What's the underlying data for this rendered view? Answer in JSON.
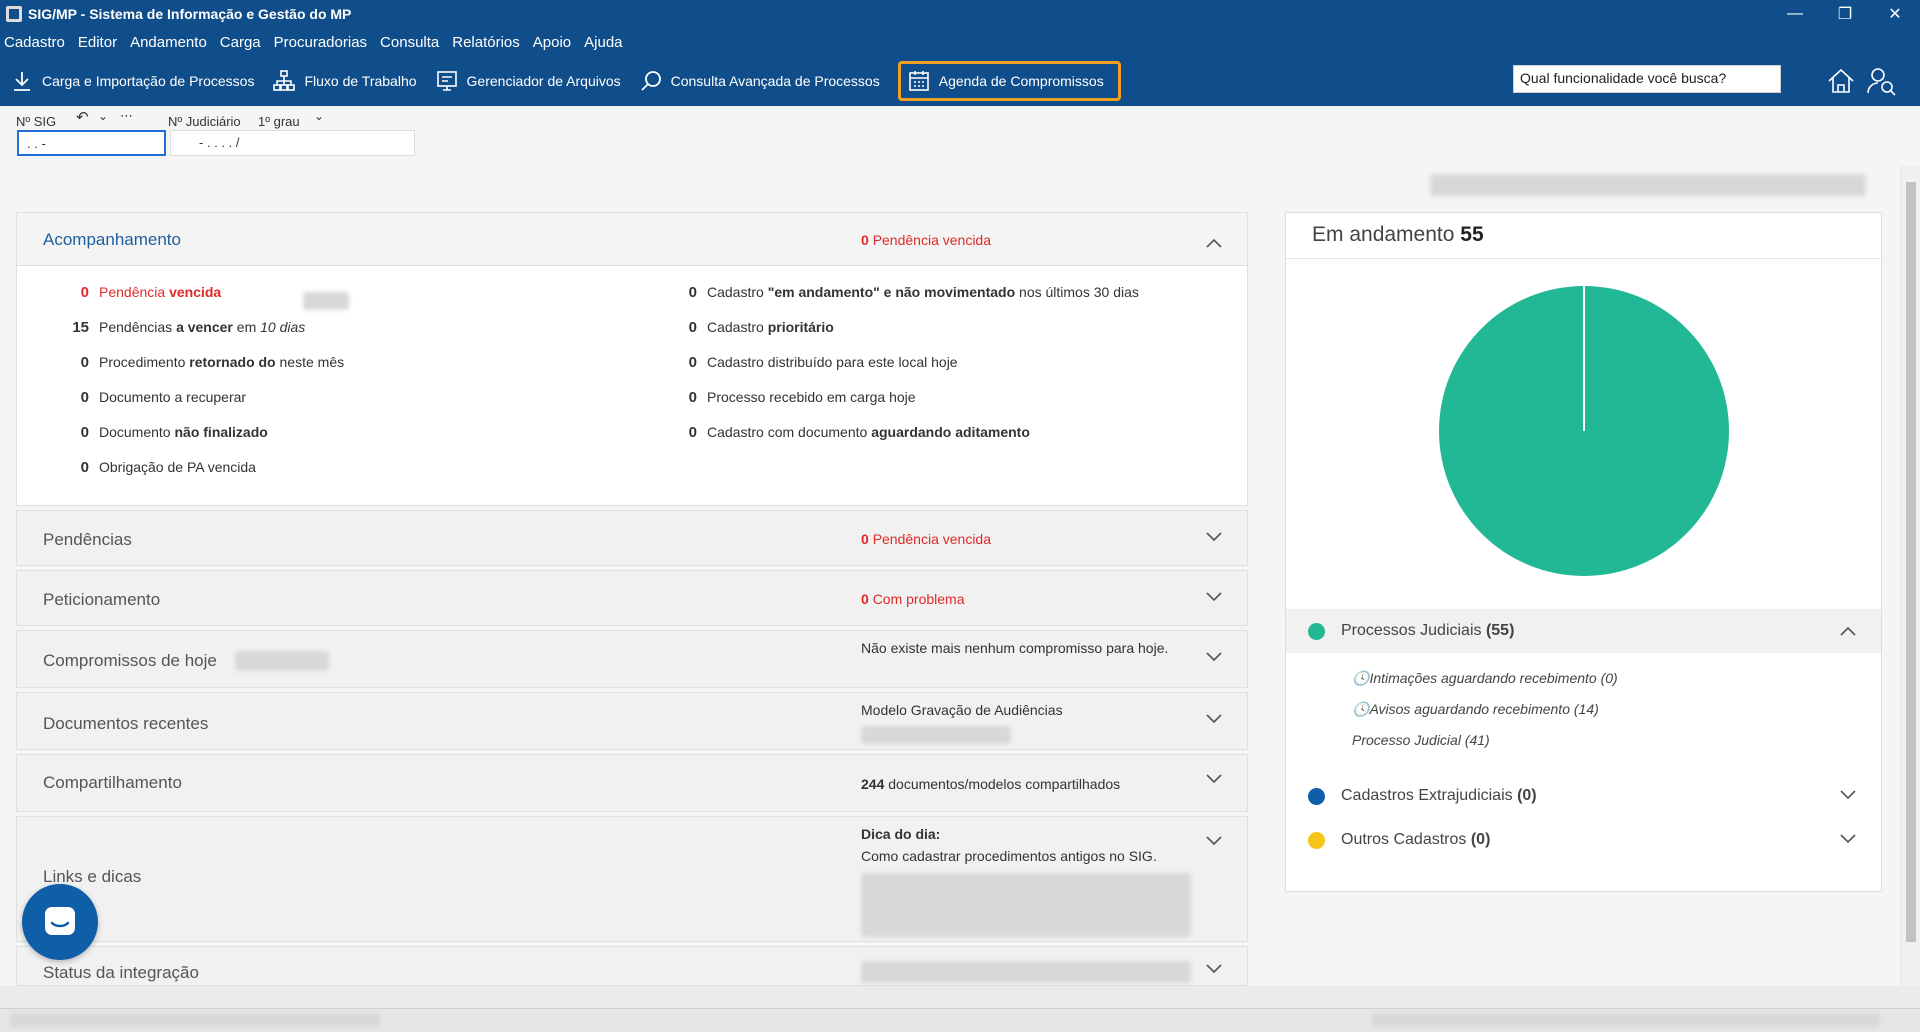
{
  "window": {
    "title": "SIG/MP - Sistema de Informação e Gestão do MP"
  },
  "menu": [
    "Cadastro",
    "Editor",
    "Andamento",
    "Carga",
    "Procuradorias",
    "Consulta",
    "Relatórios",
    "Apoio",
    "Ajuda"
  ],
  "toolbar": {
    "carga": "Carga e Importação de Processos",
    "fluxo": "Fluxo de Trabalho",
    "gerenciador": "Gerenciador de Arquivos",
    "consulta": "Consulta Avançada de Processos",
    "agenda": "Agenda de Compromissos",
    "search_value": "Qual funcionalidade você busca?"
  },
  "numbers": {
    "sig_label": "Nº SIG",
    "sig_value": ". .    -",
    "judicial_label": "Nº Judiciário",
    "grau": "1º grau",
    "judicial_value": "- .  . . .  /"
  },
  "acompanhamento": {
    "title": "Acompanhamento",
    "status_n": "0",
    "status_text": "Pendência vencida",
    "left": [
      {
        "n": "0",
        "pre": "Pendência ",
        "b": "vencida",
        "post": ""
      },
      {
        "n": "15",
        "pre": "Pendências ",
        "b": "a vencer",
        "post": " em ",
        "i": "10 dias"
      },
      {
        "n": "0",
        "pre": "Procedimento ",
        "b": "retornado do",
        "post": "  neste mês"
      },
      {
        "n": "0",
        "pre": "Documento a recuperar",
        "b": "",
        "post": ""
      },
      {
        "n": "0",
        "pre": "Documento ",
        "b": "não finalizado",
        "post": ""
      },
      {
        "n": "0",
        "pre": "Obrigação de PA vencida",
        "b": "",
        "post": ""
      }
    ],
    "right": [
      {
        "n": "0",
        "pre": "Cadastro ",
        "b": "\"em andamento\" e não movimentado",
        "post": " nos últimos 30 dias"
      },
      {
        "n": "0",
        "pre": "Cadastro ",
        "b": "prioritário",
        "post": ""
      },
      {
        "n": "0",
        "pre": "Cadastro distribuído para este local hoje",
        "b": "",
        "post": ""
      },
      {
        "n": "0",
        "pre": "Processo recebido em carga hoje",
        "b": "",
        "post": ""
      },
      {
        "n": "0",
        "pre": "Cadastro com documento ",
        "b": "aguardando aditamento",
        "post": ""
      }
    ]
  },
  "panels": {
    "pendencias": {
      "title": "Pendências",
      "n": "0",
      "text": "Pendência vencida"
    },
    "peticionamento": {
      "title": "Peticionamento",
      "n": "0",
      "text": "Com problema"
    },
    "compromissos": {
      "title": "Compromissos de hoje",
      "text": "Não existe mais nenhum compromisso para hoje."
    },
    "documentos": {
      "title": "Documentos recentes",
      "text": "Modelo Gravação de Audiências"
    },
    "compartilhamento": {
      "title": "Compartilhamento",
      "n": "244",
      "text": "documentos/modelos compartilhados"
    },
    "links": {
      "title": "Links e dicas",
      "heading": "Dica do dia:",
      "text": "Como cadastrar procedimentos antigos no SIG."
    },
    "status": {
      "title": "Status da integração"
    }
  },
  "card": {
    "title": "Em andamento",
    "total": "55",
    "legend": [
      {
        "label": "Processos Judiciais",
        "count": "(55)",
        "color": "#22b895"
      },
      {
        "label": "Cadastros Extrajudiciais",
        "count": "(0)",
        "color": "#0f5ea8"
      },
      {
        "label": "Outros Cadastros",
        "count": "(0)",
        "color": "#f5c518"
      }
    ],
    "sub": [
      "Intimações aguardando recebimento (0)",
      "Avisos aguardando recebimento (14)",
      "Processo Judicial (41)"
    ]
  },
  "chart_data": {
    "type": "pie",
    "categories": [
      "Processos Judiciais",
      "Cadastros Extrajudiciais",
      "Outros Cadastros"
    ],
    "values": [
      55,
      0,
      0
    ],
    "colors": [
      "#22b895",
      "#0f5ea8",
      "#f5c518"
    ]
  }
}
